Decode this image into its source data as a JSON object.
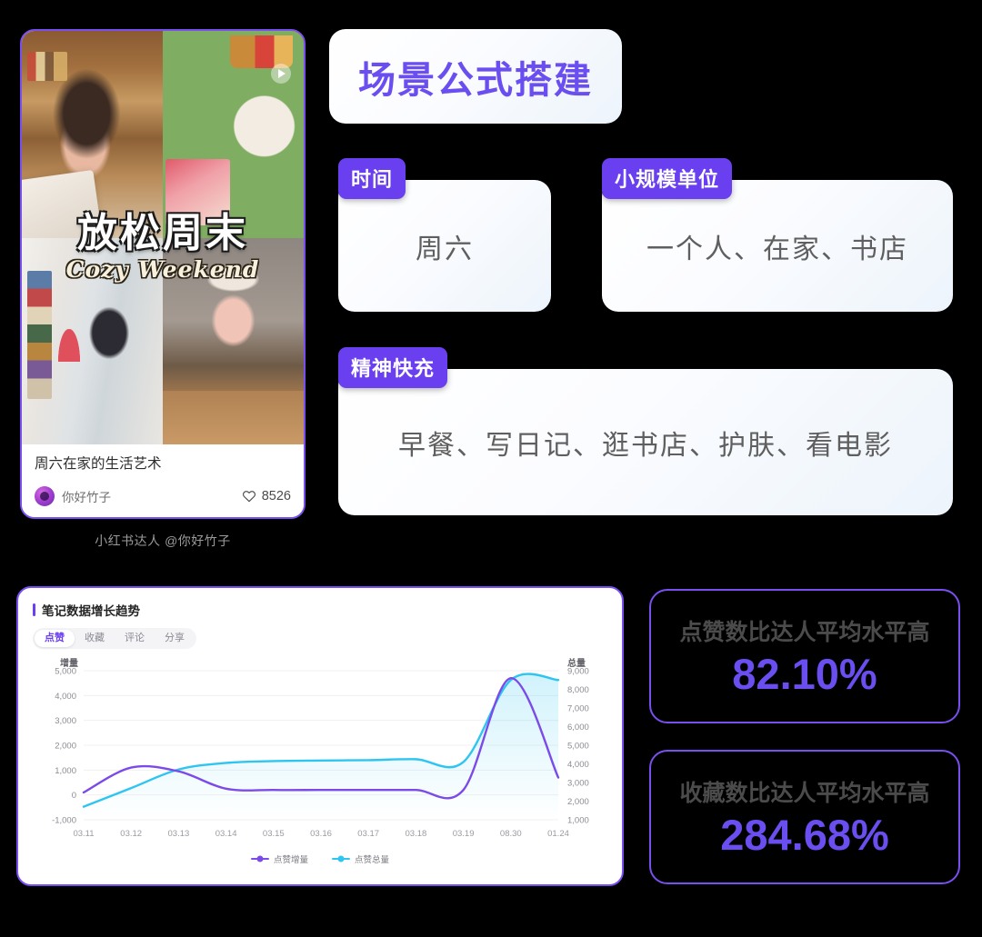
{
  "note": {
    "cover_title_cn": "放松周末",
    "cover_title_en": "Cozy Weekend",
    "play_icon": "play-icon",
    "title": "周六在家的生活艺术",
    "author": "你好竹子",
    "like_icon": "heart-icon",
    "likes": "8526",
    "caption": "小红书达人 @你好竹子"
  },
  "formula": {
    "title": "场景公式搭建",
    "slots": [
      {
        "chip": "时间",
        "value": "周六"
      },
      {
        "chip": "小规模单位",
        "value": "一个人、在家、书店"
      },
      {
        "chip": "精神快充",
        "value": "早餐、写日记、逛书店、护肤、看电影"
      }
    ]
  },
  "chart_card": {
    "title": "笔记数据增长趋势",
    "tabs": [
      {
        "label": "点赞",
        "active": true
      },
      {
        "label": "收藏",
        "active": false
      },
      {
        "label": "评论",
        "active": false
      },
      {
        "label": "分享",
        "active": false
      }
    ]
  },
  "chart_data": {
    "type": "line",
    "title": "笔记数据增长趋势",
    "xlabel": "",
    "ylabel": "增量",
    "y2label": "总量",
    "grid": true,
    "legend_position": "bottom",
    "categories": [
      "03.11",
      "03.12",
      "03.13",
      "03.14",
      "03.15",
      "03.16",
      "03.17",
      "03.18",
      "03.19",
      "08.30",
      "01.24"
    ],
    "ylim": [
      -1000,
      5000
    ],
    "yticks": [
      "5,000",
      "4,000",
      "3,000",
      "2,000",
      "1,000",
      "0",
      "-1,000"
    ],
    "y2lim": [
      1000,
      9000
    ],
    "y2ticks": [
      "9,000",
      "8,000",
      "7,000",
      "6,000",
      "5,000",
      "4,000",
      "3,000",
      "2,000",
      "1,000"
    ],
    "series": [
      {
        "name": "点赞增量",
        "color": "#7b4ae8",
        "axis": "left",
        "values": [
          100,
          1100,
          950,
          250,
          200,
          200,
          200,
          200,
          200,
          4700,
          700
        ]
      },
      {
        "name": "点赞总量",
        "color": "#2ec5f0",
        "axis": "right",
        "values": [
          1700,
          2700,
          3700,
          4050,
          4150,
          4180,
          4200,
          4250,
          4100,
          8500,
          8500
        ]
      }
    ]
  },
  "stats": [
    {
      "label": "点赞数比达人平均水平高",
      "value": "82.10%"
    },
    {
      "label": "收藏数比达人平均水平高",
      "value": "284.68%"
    }
  ],
  "colors": {
    "accent_purple": "#6a3ff0",
    "title_purple": "#6b4ef0",
    "series_increment": "#7b4ae8",
    "series_total": "#2ec5f0",
    "background": "#000000"
  }
}
